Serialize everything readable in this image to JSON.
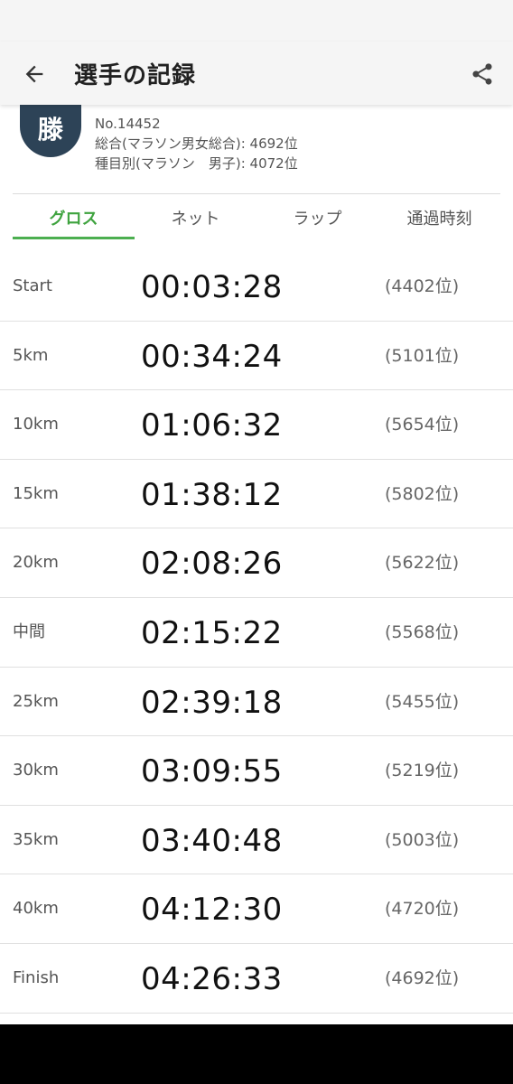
{
  "appbar": {
    "title": "選手の記録",
    "back_icon": "arrow-left-icon",
    "share_icon": "share-icon"
  },
  "profile": {
    "avatar_char": "滕",
    "avatar_color": "#2d4357",
    "number": "No.14452",
    "overall_rank": "総合(マラソン男女総合): 4692位",
    "category_rank": "種目別(マラソン　男子): 4072位"
  },
  "tabs": [
    {
      "label": "グロス",
      "active": true
    },
    {
      "label": "ネット",
      "active": false
    },
    {
      "label": "ラップ",
      "active": false
    },
    {
      "label": "通過時刻",
      "active": false
    }
  ],
  "accent_color": "#4caf50",
  "splits": [
    {
      "label": "Start",
      "time": "00:03:28",
      "rank": "(4402位)"
    },
    {
      "label": "5km",
      "time": "00:34:24",
      "rank": "(5101位)"
    },
    {
      "label": "10km",
      "time": "01:06:32",
      "rank": "(5654位)"
    },
    {
      "label": "15km",
      "time": "01:38:12",
      "rank": "(5802位)"
    },
    {
      "label": "20km",
      "time": "02:08:26",
      "rank": "(5622位)"
    },
    {
      "label": "中間",
      "time": "02:15:22",
      "rank": "(5568位)"
    },
    {
      "label": "25km",
      "time": "02:39:18",
      "rank": "(5455位)"
    },
    {
      "label": "30km",
      "time": "03:09:55",
      "rank": "(5219位)"
    },
    {
      "label": "35km",
      "time": "03:40:48",
      "rank": "(5003位)"
    },
    {
      "label": "40km",
      "time": "04:12:30",
      "rank": "(4720位)"
    },
    {
      "label": "Finish",
      "time": "04:26:33",
      "rank": "(4692位)"
    }
  ]
}
